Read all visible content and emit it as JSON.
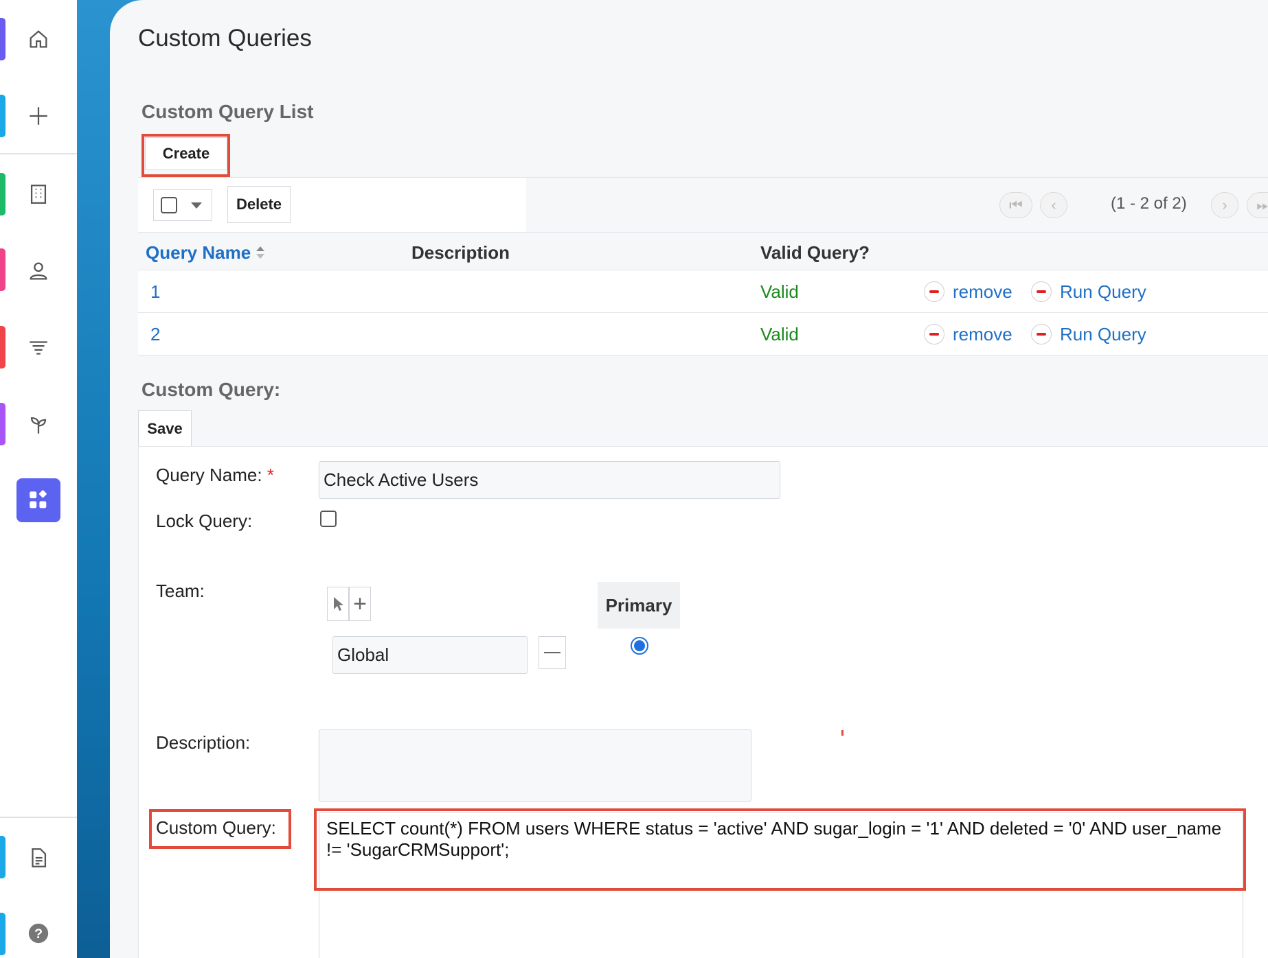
{
  "page": {
    "title": "Custom Queries"
  },
  "rail": {
    "icons": [
      "home-icon",
      "plus-icon",
      "building-icon",
      "contact-icon",
      "filter-icon",
      "sprout-icon",
      "apps-icon",
      "document-icon",
      "help-icon"
    ],
    "stripe_colors": [
      "#6a5cf0",
      "#1aa8e8",
      "#1dba6a",
      "#f0448a",
      "#f0444a",
      "#a855f7",
      "#1aa8e8",
      "#1aa8e8"
    ],
    "active_color": "#5b63f0"
  },
  "list": {
    "title": "Custom Query List",
    "create_label": "Create",
    "delete_label": "Delete",
    "pagination": "(1 - 2 of 2)",
    "columns": [
      "Query Name",
      "Description",
      "Valid Query?"
    ],
    "rows": [
      {
        "name": "1",
        "description": "",
        "valid": "Valid",
        "remove": "remove",
        "run": "Run Query"
      },
      {
        "name": "2",
        "description": "",
        "valid": "Valid",
        "remove": "remove",
        "run": "Run Query"
      }
    ]
  },
  "form": {
    "title": "Custom Query:",
    "save_label": "Save",
    "query_name_label": "Query Name:",
    "required_mark": "*",
    "query_name_value": "Check Active Users",
    "lock_label": "Lock Query:",
    "lock_checked": false,
    "team_label": "Team:",
    "primary_label": "Primary",
    "team_value": "Global",
    "description_label": "Description:",
    "description_value": "",
    "custom_query_label": "Custom Query:",
    "custom_query_value": "SELECT count(*) FROM users WHERE status = 'active' AND sugar_login = '1' AND deleted = '0' AND user_name != 'SugarCRMSupport';"
  },
  "colors": {
    "link": "#1f6fc6",
    "valid": "#1a8a1a",
    "highlight": "#e14b3b",
    "accent": "#2a93d0"
  }
}
